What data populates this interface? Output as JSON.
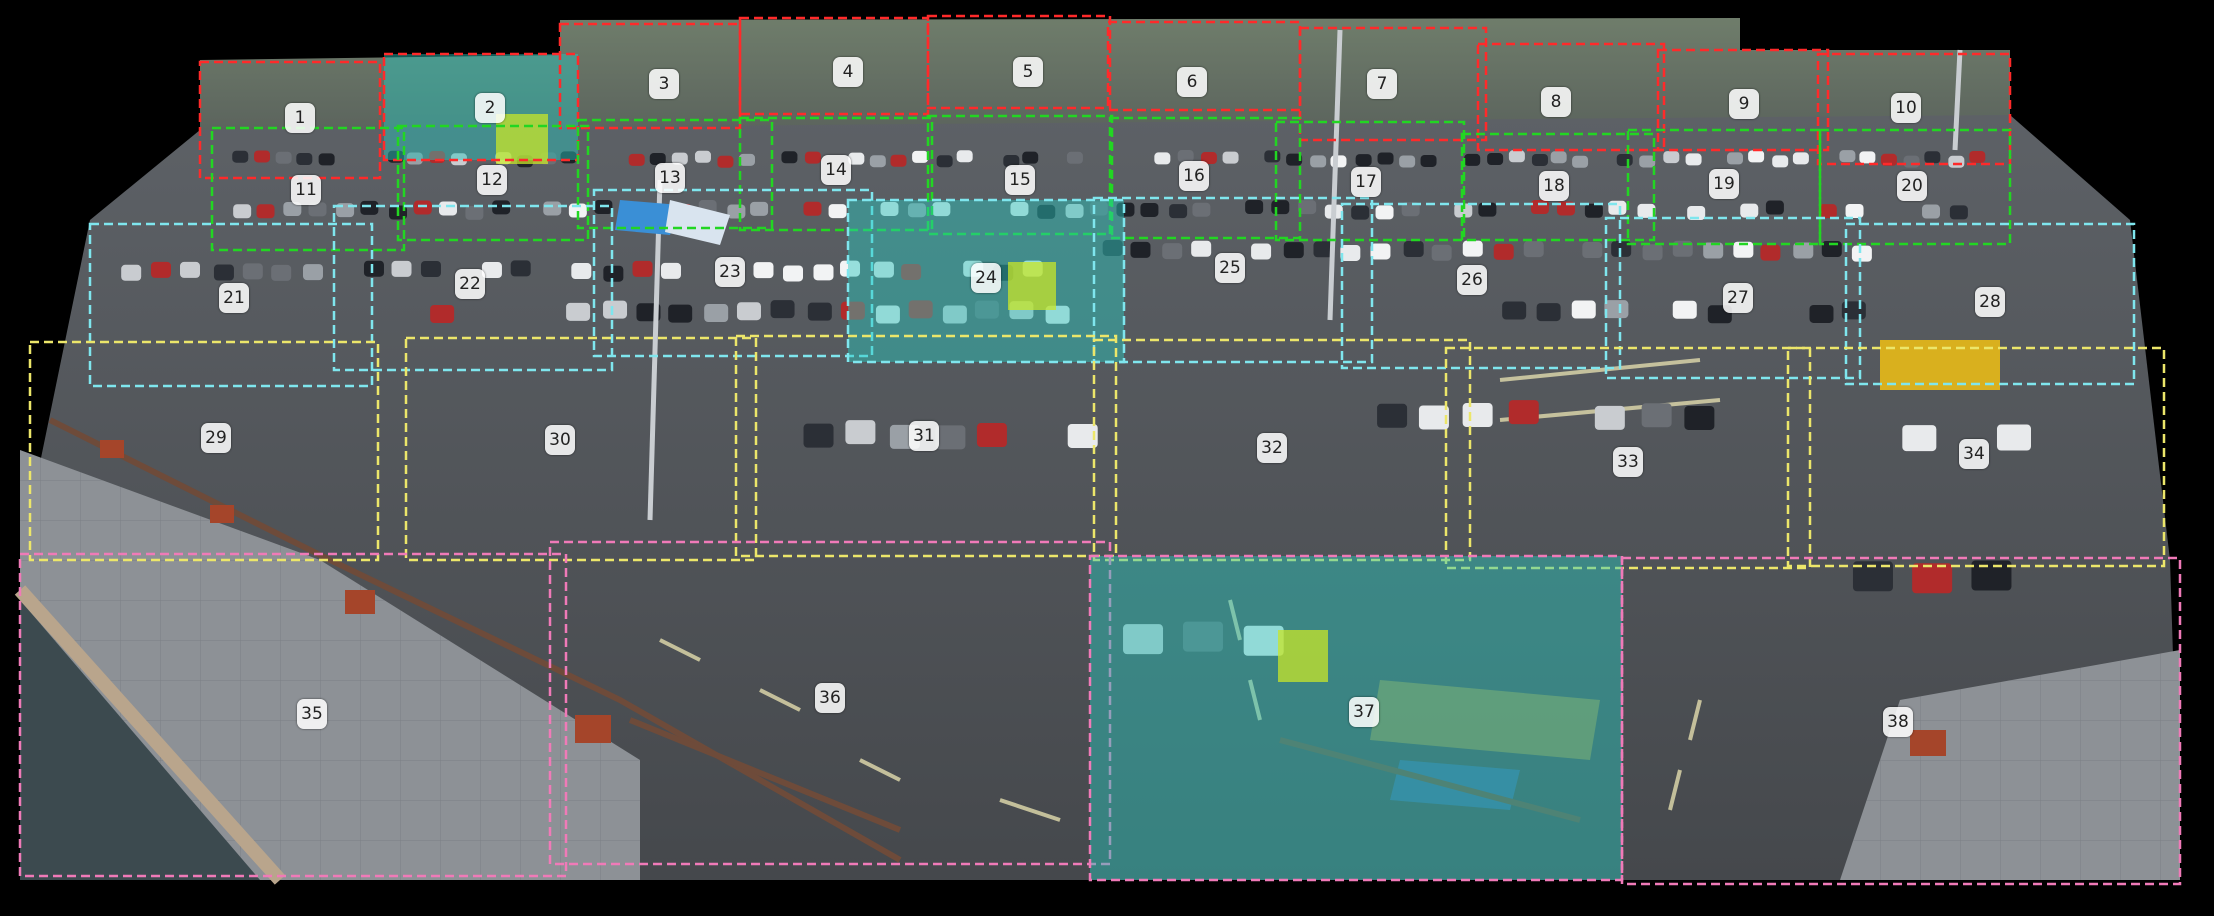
{
  "image": {
    "description_colors": {
      "background": "#000000",
      "asphalt": "#4a4d52",
      "plaza": "#8b8f94",
      "far_lot": "#5c6064"
    }
  },
  "legend_colors": {
    "red": "#ff2a2a",
    "green": "#22d622",
    "cyan": "#7fe6ee",
    "yellow": "#ece66a",
    "pink": "#f07ab8",
    "highlight_fill": "rgba(40,200,190,0.45)",
    "marker_fill": "rgba(200,230,40,0.75)"
  },
  "regions": [
    {
      "label": "1",
      "group": "red"
    },
    {
      "label": "2",
      "group": "red",
      "highlighted": true
    },
    {
      "label": "3",
      "group": "red"
    },
    {
      "label": "4",
      "group": "red"
    },
    {
      "label": "5",
      "group": "red"
    },
    {
      "label": "6",
      "group": "red"
    },
    {
      "label": "7",
      "group": "red"
    },
    {
      "label": "8",
      "group": "red"
    },
    {
      "label": "9",
      "group": "red"
    },
    {
      "label": "10",
      "group": "red"
    },
    {
      "label": "11",
      "group": "green"
    },
    {
      "label": "12",
      "group": "green"
    },
    {
      "label": "13",
      "group": "green"
    },
    {
      "label": "14",
      "group": "green"
    },
    {
      "label": "15",
      "group": "green"
    },
    {
      "label": "16",
      "group": "green"
    },
    {
      "label": "17",
      "group": "green"
    },
    {
      "label": "18",
      "group": "green"
    },
    {
      "label": "19",
      "group": "green"
    },
    {
      "label": "20",
      "group": "green"
    },
    {
      "label": "21",
      "group": "cyan"
    },
    {
      "label": "22",
      "group": "cyan"
    },
    {
      "label": "23",
      "group": "cyan"
    },
    {
      "label": "24",
      "group": "cyan",
      "highlighted": true
    },
    {
      "label": "25",
      "group": "cyan"
    },
    {
      "label": "26",
      "group": "cyan"
    },
    {
      "label": "27",
      "group": "cyan"
    },
    {
      "label": "28",
      "group": "cyan"
    },
    {
      "label": "29",
      "group": "yellow"
    },
    {
      "label": "30",
      "group": "yellow"
    },
    {
      "label": "31",
      "group": "yellow"
    },
    {
      "label": "32",
      "group": "yellow"
    },
    {
      "label": "33",
      "group": "yellow"
    },
    {
      "label": "34",
      "group": "yellow"
    },
    {
      "label": "35",
      "group": "pink"
    },
    {
      "label": "36",
      "group": "pink"
    },
    {
      "label": "37",
      "group": "pink",
      "highlighted": true
    },
    {
      "label": "38",
      "group": "pink"
    }
  ]
}
